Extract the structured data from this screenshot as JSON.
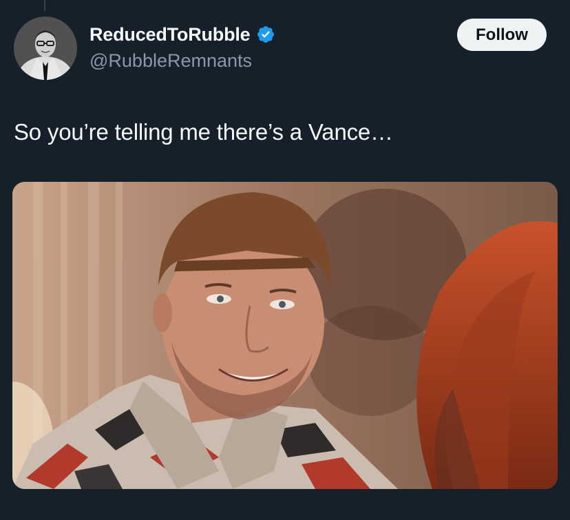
{
  "tweet": {
    "author": {
      "display_name": "ReducedToRubble",
      "handle": "@RubbleRemnants",
      "verified": true,
      "verified_icon": "verified-badge-icon",
      "verified_color": "#1d9bf0"
    },
    "follow_label": "Follow",
    "text": "So you’re telling me there’s a Vance…",
    "media": {
      "type": "photo",
      "description": "movie still of smiling man with bowl haircut in patterned shirt facing red-haired woman"
    }
  },
  "colors": {
    "background": "#15202b",
    "text_primary": "#f7f9f9",
    "text_secondary": "#8b98a5",
    "button_bg": "#eff3f4"
  }
}
